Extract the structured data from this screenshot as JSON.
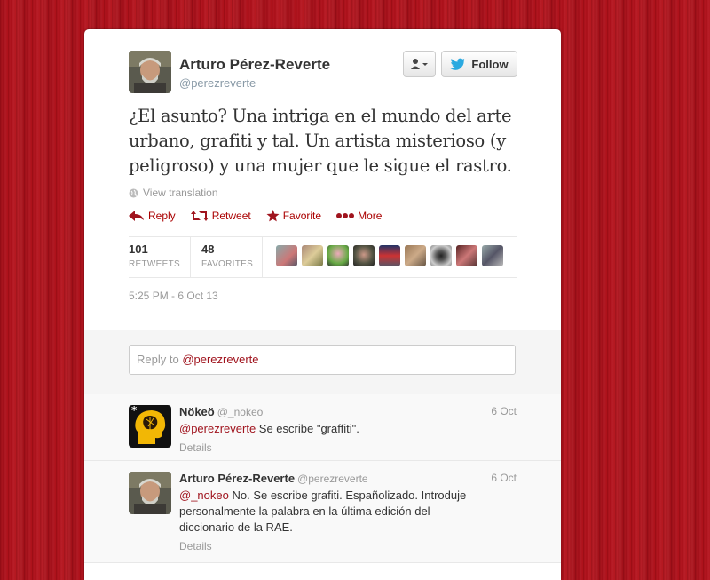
{
  "tweet": {
    "author_name": "Arturo Pérez-Reverte",
    "author_handle": "@perezreverte",
    "follow_label": "Follow",
    "text": "¿El asunto? Una intriga en el mundo del arte urbano, grafiti y tal. Un artista misterioso (y peligroso) y una mujer que le sigue el rastro.",
    "view_translation": "View translation",
    "actions": {
      "reply": "Reply",
      "retweet": "Retweet",
      "favorite": "Favorite",
      "more": "More"
    },
    "stats": {
      "retweets_count": "101",
      "retweets_label": "RETWEETS",
      "favorites_count": "48",
      "favorites_label": "FAVORITES"
    },
    "timestamp": "5:25 PM - 6 Oct 13"
  },
  "reply_box": {
    "prefix": "Reply to ",
    "mention": "@perezreverte"
  },
  "replies": [
    {
      "name": "Nökeö",
      "handle": "@_nokeo",
      "date": "6 Oct",
      "mention": "@perezreverte",
      "text": " Se escribe \"graffiti\".",
      "details": "Details"
    },
    {
      "name": "Arturo Pérez-Reverte",
      "handle": "@perezreverte",
      "date": "6 Oct",
      "mention": "@_nokeo",
      "text": " No. Se escribe grafiti. Españolizado. Introduje personalmente la palabra en la última edición del diccionario de la RAE.",
      "details": "Details"
    }
  ],
  "colors": {
    "background": "#b3101a",
    "accent": "#a0141e",
    "twitter_blue": "#2aa9e0"
  }
}
